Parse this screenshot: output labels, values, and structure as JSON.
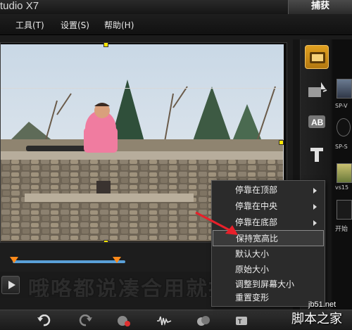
{
  "window": {
    "title": "tudio X7",
    "capture_tab": "捕获"
  },
  "menu": {
    "items": [
      "工具(T)",
      "设置(S)",
      "帮助(H)"
    ]
  },
  "library": {
    "thumbs": [
      {
        "label": "SP-V"
      },
      {
        "label": "SP-S"
      },
      {
        "label": "vs15"
      },
      {
        "label": "开始"
      }
    ]
  },
  "context_menu": {
    "items": [
      {
        "label": "停靠在顶部",
        "submenu": true
      },
      {
        "label": "停靠在中央",
        "submenu": true
      },
      {
        "label": "停靠在底部",
        "submenu": true
      },
      {
        "label": "保持宽高比",
        "submenu": false,
        "active": true
      },
      {
        "label": "默认大小",
        "submenu": false
      },
      {
        "label": "原始大小",
        "submenu": false
      },
      {
        "label": "调整到屏幕大小",
        "submenu": false
      },
      {
        "label": "重置变形",
        "submenu": false
      }
    ]
  },
  "playback": {
    "obscured_text": "哦咯都说凑合用就把很多都"
  },
  "watermark": {
    "url": "jb51.net",
    "name": "脚本之家"
  },
  "colors": {
    "accent_orange": "#ff8a1a",
    "timeline_blue": "#5aa0d8",
    "handle_yellow": "#ffe600",
    "annotation_red": "#e8202a"
  }
}
